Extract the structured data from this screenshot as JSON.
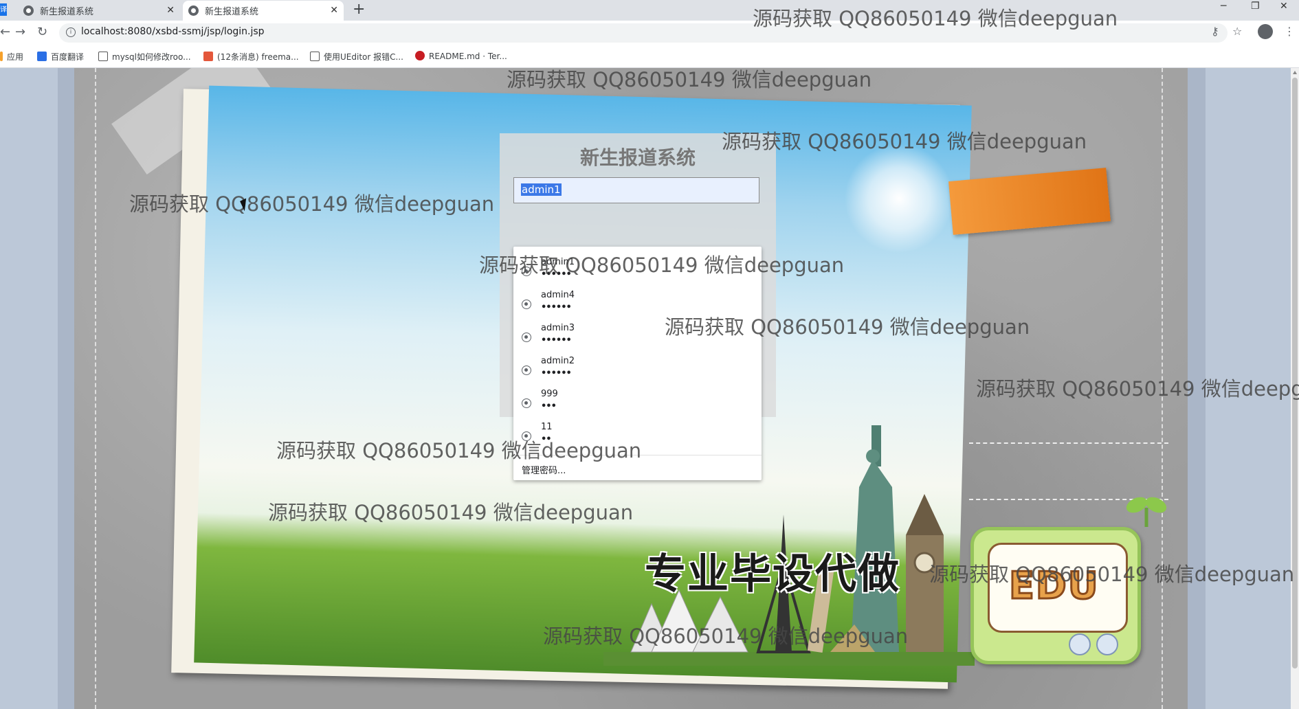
{
  "browser": {
    "tabs": [
      {
        "label": "新生报道系统",
        "active": false
      },
      {
        "label": "新生报道系统",
        "active": true
      }
    ],
    "new_tab_symbol": "+",
    "url": "localhost:8080/xsbd-ssmj/jsp/login.jsp",
    "bookmarks": [
      {
        "label": "应用",
        "icon": "apps-icon"
      },
      {
        "label": "百度翻译",
        "icon": "baidu-translate-icon"
      },
      {
        "label": "mysql如何修改roo...",
        "icon": "mysql-icon"
      },
      {
        "label": "(12条消息) freema...",
        "icon": "csdn-icon"
      },
      {
        "label": "使用UEditor 报错C...",
        "icon": "mysql-icon"
      },
      {
        "label": "README.md · Ter...",
        "icon": "gitee-icon"
      }
    ]
  },
  "login": {
    "title": "新生报道系统",
    "username_value": "admin1"
  },
  "autofill": {
    "items": [
      {
        "user": "admin1",
        "pass": "••••••"
      },
      {
        "user": "admin4",
        "pass": "••••••"
      },
      {
        "user": "admin3",
        "pass": "••••••"
      },
      {
        "user": "admin2",
        "pass": "••••••"
      },
      {
        "user": "999",
        "pass": "•••"
      },
      {
        "user": "11",
        "pass": "••"
      }
    ],
    "manage_label": "管理密码..."
  },
  "background": {
    "slogan": "专业毕设代做",
    "edu_logo": "EDU"
  },
  "watermark_text": "源码获取 QQ86050149 微信deepguan"
}
